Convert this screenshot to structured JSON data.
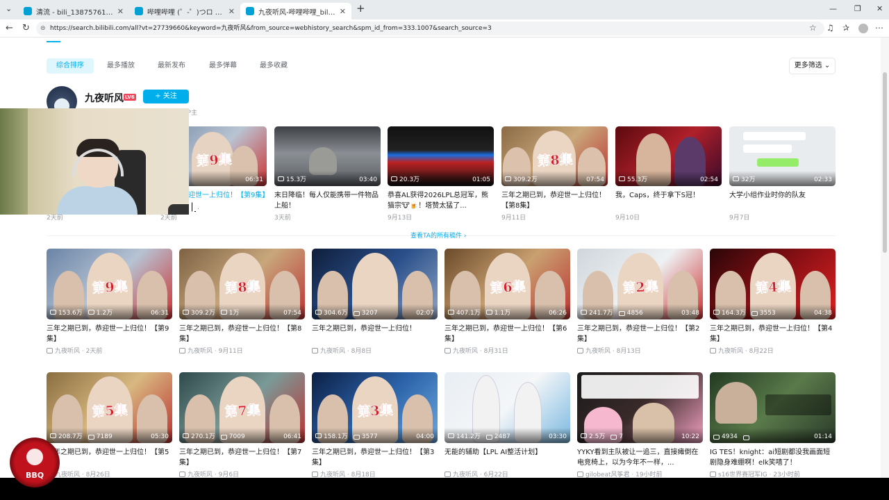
{
  "browser": {
    "tabs": [
      {
        "label": "清流 - bili_1387576123 - 哔哩"
      },
      {
        "label": "哔哩哔哩 (゜-゜)つロ 干杯~-bilibili"
      },
      {
        "label": "九夜听风-哔哩哔哩_bilibili"
      }
    ],
    "url": "https://search.bilibili.com/all?vt=27739660&keyword=九夜听风&from_source=webhistory_search&spm_id_from=333.1007&search_source=3",
    "new_tab": "+"
  },
  "sort_tabs": [
    "综合排序",
    "最多播放",
    "最新发布",
    "最多弹幕",
    "最多收藏"
  ],
  "more_filter": "更多筛选",
  "up": {
    "name": "九夜听风",
    "level_badge": "LV6",
    "follow_label": "+ 关注",
    "tag": "UP主"
  },
  "up_videos": [
    {
      "plays": "",
      "duration": "06:31",
      "title": "已到，恭迎世一上归位！【第9集】",
      "date": "2天前",
      "ep": "第9集"
    },
    {
      "plays": "15.3万",
      "duration": "03:40",
      "title": "末日降临！每人仅能携带一件物品上船！",
      "date": "3天前",
      "ep": ""
    },
    {
      "plays": "20.3万",
      "duration": "01:05",
      "title": "恭喜AL获得2026LPL总冠军，熊猫宗🐮🍺！塔赞太猛了...",
      "date": "9月13日",
      "ep": ""
    },
    {
      "plays": "309.2万",
      "duration": "07:54",
      "title": "三年之期已到，恭迎世一上归位！【第8集】",
      "date": "9月11日",
      "ep": "第8集"
    },
    {
      "plays": "55.3万",
      "duration": "02:54",
      "title": "我，Caps，终于拿下S冠！",
      "date": "9月10日",
      "ep": ""
    },
    {
      "plays": "32万",
      "duration": "02:33",
      "title": "大学小组作业时你的队友",
      "date": "9月7日",
      "ep": ""
    }
  ],
  "first_row_left_date": "2天前",
  "view_all": "查看TA的所有稿件 ›",
  "grid_videos": [
    {
      "plays": "153.6万",
      "danmaku": "1.2万",
      "duration": "06:31",
      "title": "三年之期已到，恭迎世一上归位！【第9集】",
      "author": "九夜听风",
      "date": "2天前",
      "ep": "第9集"
    },
    {
      "plays": "309.2万",
      "danmaku": "1万",
      "duration": "07:54",
      "title": "三年之期已到，恭迎世一上归位！【第8集】",
      "author": "九夜听风",
      "date": "9月11日",
      "ep": "第8集"
    },
    {
      "plays": "304.6万",
      "danmaku": "3207",
      "duration": "02:07",
      "title": "三年之期已到，恭迎世一上归位！",
      "author": "九夜听风",
      "date": "8月8日",
      "ep": ""
    },
    {
      "plays": "407.1万",
      "danmaku": "1.1万",
      "duration": "06:26",
      "title": "三年之期已到，恭迎世一上归位！【第6集】",
      "author": "九夜听风",
      "date": "8月31日",
      "ep": "第6集"
    },
    {
      "plays": "241.7万",
      "danmaku": "4856",
      "duration": "03:48",
      "title": "三年之期已到，恭迎世一上归位！【第2集】",
      "author": "九夜听风",
      "date": "8月13日",
      "ep": "第2集"
    },
    {
      "plays": "164.3万",
      "danmaku": "3553",
      "duration": "04:38",
      "title": "三年之期已到，恭迎世一上归位！【第4集】",
      "author": "九夜听风",
      "date": "8月22日",
      "ep": "第4集"
    },
    {
      "plays": "208.7万",
      "danmaku": "7189",
      "duration": "05:30",
      "title": "三年之期已到，恭迎世一上归位！【第5集】",
      "author": "九夜听风",
      "date": "8月26日",
      "ep": "第5集"
    },
    {
      "plays": "270.1万",
      "danmaku": "7009",
      "duration": "06:41",
      "title": "三年之期已到，恭迎世一上归位！【第7集】",
      "author": "九夜听风",
      "date": "9月6日",
      "ep": "第7集"
    },
    {
      "plays": "158.1万",
      "danmaku": "3577",
      "duration": "04:00",
      "title": "三年之期已到，恭迎世一上归位！【第3集】",
      "author": "九夜听风",
      "date": "8月18日",
      "ep": "第3集"
    },
    {
      "plays": "141.2万",
      "danmaku": "2487",
      "duration": "03:30",
      "title": "无能的辅助【LPL AI整活计划】",
      "author": "九夜听风",
      "date": "6月22日",
      "ep": ""
    },
    {
      "plays": "2.5万",
      "danmaku": "7",
      "duration": "10:22",
      "title": "YYKY看到主队被让一追三，直接瘫倒在电竞椅上，以为今年不一样，...",
      "author": "gilobeat风筝君",
      "date": "19小时前",
      "ep": ""
    },
    {
      "plays": "4934",
      "danmaku": "",
      "duration": "01:14",
      "title": "IG TES！knight：ai短剧都没我画面短剧隐身难绷啊！elk笑嘻了！",
      "author": "s16世界赛冠军IG",
      "date": "23小时前",
      "ep": ""
    }
  ],
  "overlay": {
    "logo_text": "BBQ"
  }
}
